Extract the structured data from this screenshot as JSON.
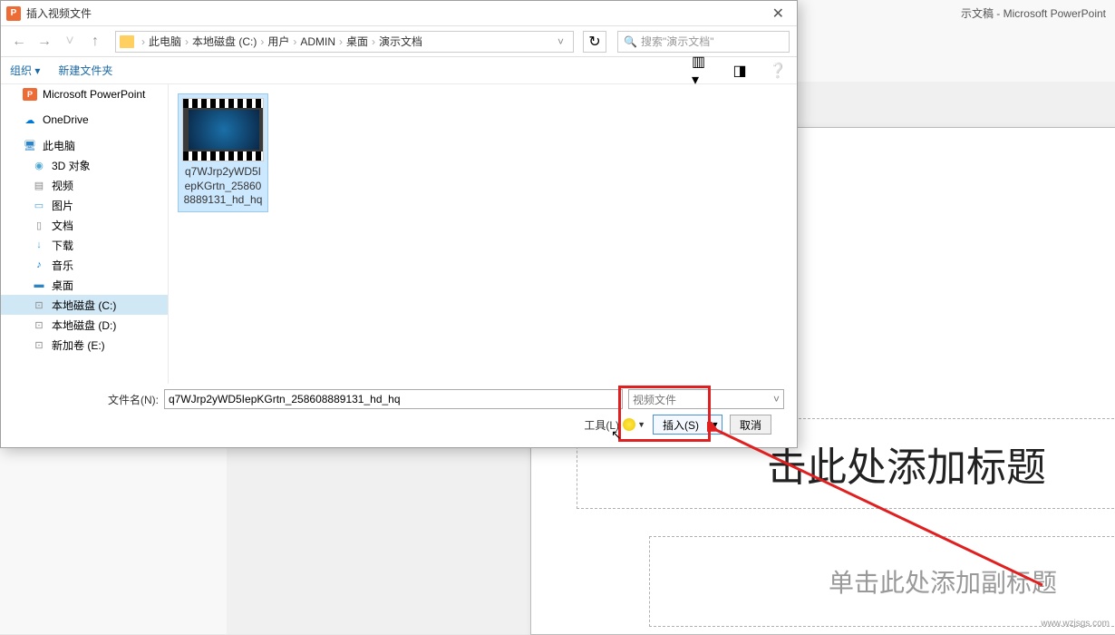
{
  "ppt": {
    "app_title": "示文稿 - Microsoft PowerPoint",
    "title_placeholder": "击此处添加标题",
    "subtitle_placeholder": "单击此处添加副标题"
  },
  "dialog": {
    "title": "插入视频文件",
    "close": "✕",
    "nav": {
      "back": "←",
      "forward": "→",
      "up": "↑"
    },
    "breadcrumb": {
      "items": [
        "此电脑",
        "本地磁盘 (C:)",
        "用户",
        "ADMIN",
        "桌面",
        "演示文档"
      ],
      "sep": "›"
    },
    "refresh": "↻",
    "search_placeholder": "搜索\"演示文档\"",
    "toolbar": {
      "organize": "组织 ▾",
      "new_folder": "新建文件夹"
    },
    "sidebar": [
      {
        "label": "Microsoft PowerPoint",
        "icon": "icon-ppt",
        "tag": "P",
        "level": 0
      },
      {
        "label": "OneDrive",
        "icon": "icon-onedrive",
        "tag": "☁",
        "level": 0
      },
      {
        "label": "此电脑",
        "icon": "icon-pc",
        "tag": "🖥",
        "level": 0
      },
      {
        "label": "3D 对象",
        "icon": "icon-3d",
        "tag": "◉",
        "level": 1
      },
      {
        "label": "视频",
        "icon": "icon-video",
        "tag": "▤",
        "level": 1
      },
      {
        "label": "图片",
        "icon": "icon-pic",
        "tag": "▭",
        "level": 1
      },
      {
        "label": "文档",
        "icon": "icon-doc",
        "tag": "▯",
        "level": 1
      },
      {
        "label": "下载",
        "icon": "icon-download",
        "tag": "↓",
        "level": 1
      },
      {
        "label": "音乐",
        "icon": "icon-music",
        "tag": "♪",
        "level": 1
      },
      {
        "label": "桌面",
        "icon": "icon-desktop",
        "tag": "▬",
        "level": 1
      },
      {
        "label": "本地磁盘 (C:)",
        "icon": "icon-drive",
        "tag": "⊡",
        "level": 1,
        "selected": true
      },
      {
        "label": "本地磁盘 (D:)",
        "icon": "icon-drive",
        "tag": "⊡",
        "level": 1
      },
      {
        "label": "新加卷 (E:)",
        "icon": "icon-drive",
        "tag": "⊡",
        "level": 1
      }
    ],
    "file": {
      "name": "q7WJrp2yWD5IepKGrtn_258608889131_hd_hq"
    },
    "footer": {
      "fn_label": "文件名(N):",
      "fn_value": "q7WJrp2yWD5IepKGrtn_258608889131_hd_hq",
      "filetype": "视频文件",
      "tools": "工具(L)",
      "insert": "插入(S)",
      "cancel": "取消"
    }
  },
  "watermark": "www.wzjsgs.com"
}
